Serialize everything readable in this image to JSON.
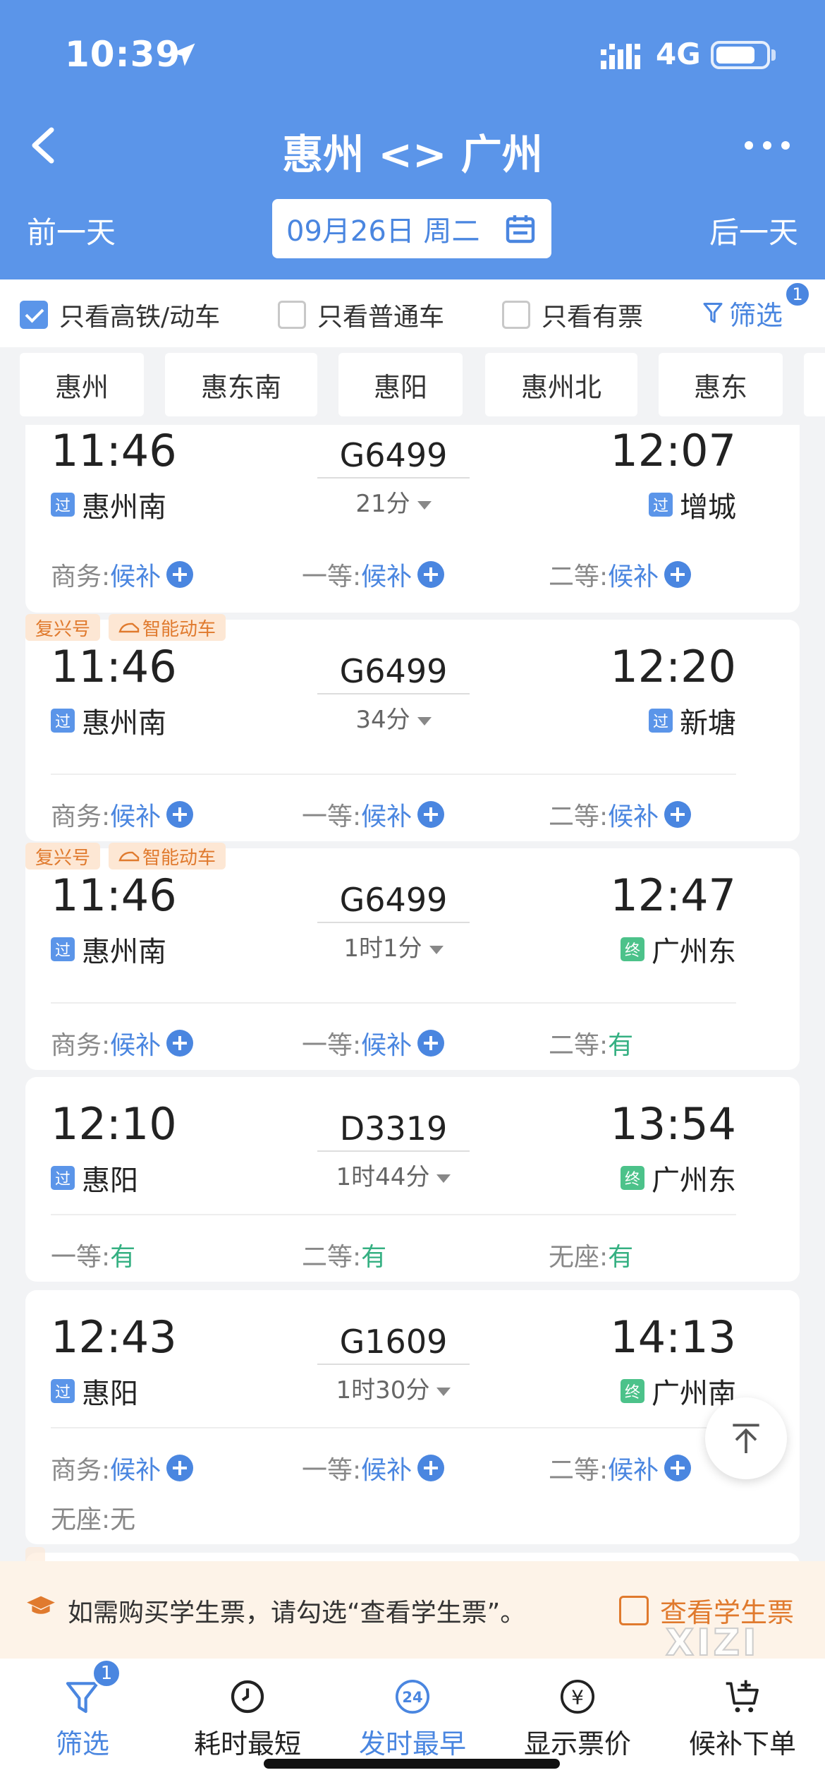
{
  "status_bar": {
    "time": "10:39",
    "network": "4G"
  },
  "nav": {
    "title": "惠州 <> 广州"
  },
  "date_bar": {
    "prev": "前一天",
    "date": "09月26日 周二",
    "next": "后一天"
  },
  "filters": {
    "high_speed": {
      "label": "只看高铁/动车",
      "checked": true
    },
    "normal": {
      "label": "只看普通车",
      "checked": false
    },
    "available": {
      "label": "只看有票",
      "checked": false
    },
    "filter_btn": "筛选",
    "filter_count": "1"
  },
  "stations": [
    "惠州",
    "惠东南",
    "惠阳",
    "惠州北",
    "惠东"
  ],
  "trains": [
    {
      "tags": [],
      "dep_time": "11:46",
      "dep_station": "惠州南",
      "dep_type": "过",
      "train_no": "G6499",
      "duration": "21分",
      "arr_time": "12:07",
      "arr_station": "增城",
      "arr_type": "过",
      "seats": [
        {
          "label": "商务:",
          "value": "候补"
        },
        {
          "label": "一等:",
          "value": "候补"
        },
        {
          "label": "二等:",
          "value": "候补"
        }
      ]
    },
    {
      "tags": [
        "复兴号",
        "智能动车"
      ],
      "dep_time": "11:46",
      "dep_station": "惠州南",
      "dep_type": "过",
      "train_no": "G6499",
      "duration": "34分",
      "arr_time": "12:20",
      "arr_station": "新塘",
      "arr_type": "过",
      "seats": [
        {
          "label": "商务:",
          "value": "候补"
        },
        {
          "label": "一等:",
          "value": "候补"
        },
        {
          "label": "二等:",
          "value": "候补"
        }
      ]
    },
    {
      "tags": [
        "复兴号",
        "智能动车"
      ],
      "dep_time": "11:46",
      "dep_station": "惠州南",
      "dep_type": "过",
      "train_no": "G6499",
      "duration": "1时1分",
      "arr_time": "12:47",
      "arr_station": "广州东",
      "arr_type": "终",
      "seats": [
        {
          "label": "商务:",
          "value": "候补"
        },
        {
          "label": "一等:",
          "value": "候补"
        },
        {
          "label": "二等:",
          "value": "有"
        }
      ]
    },
    {
      "tags": [],
      "dep_time": "12:10",
      "dep_station": "惠阳",
      "dep_type": "过",
      "train_no": "D3319",
      "duration": "1时44分",
      "arr_time": "13:54",
      "arr_station": "广州东",
      "arr_type": "终",
      "seats": [
        {
          "label": "一等:",
          "value": "有"
        },
        {
          "label": "二等:",
          "value": "有"
        },
        {
          "label": "无座:",
          "value": "有"
        }
      ]
    },
    {
      "tags": [],
      "dep_time": "12:43",
      "dep_station": "惠阳",
      "dep_type": "过",
      "train_no": "G1609",
      "duration": "1时30分",
      "arr_time": "14:13",
      "arr_station": "广州南",
      "arr_type": "终",
      "seats": [
        {
          "label": "商务:",
          "value": "候补"
        },
        {
          "label": "一等:",
          "value": "候补"
        },
        {
          "label": "二等:",
          "value": "候补"
        },
        {
          "label": "无座:",
          "value": "无"
        }
      ]
    }
  ],
  "student_banner": {
    "text": "如需购买学生票，请勾选“查看学生票”。",
    "checkbox_label": "查看学生票",
    "watermark": "XIZI"
  },
  "bottom_tabs": [
    {
      "label": "筛选",
      "icon": "funnel-icon",
      "badge": "1",
      "active": true
    },
    {
      "label": "耗时最短",
      "icon": "clock-icon",
      "active": false
    },
    {
      "label": "发时最早",
      "icon": "24h-icon",
      "icon_text": "24",
      "active": true
    },
    {
      "label": "显示票价",
      "icon": "yuan-icon",
      "icon_text": "¥",
      "active": false
    },
    {
      "label": "候补下单",
      "icon": "cart-add-icon",
      "active": false
    }
  ],
  "colors": {
    "primary": "#5b95e9",
    "link": "#4a86e0",
    "available": "#35b082",
    "orange": "#e07a2e"
  }
}
